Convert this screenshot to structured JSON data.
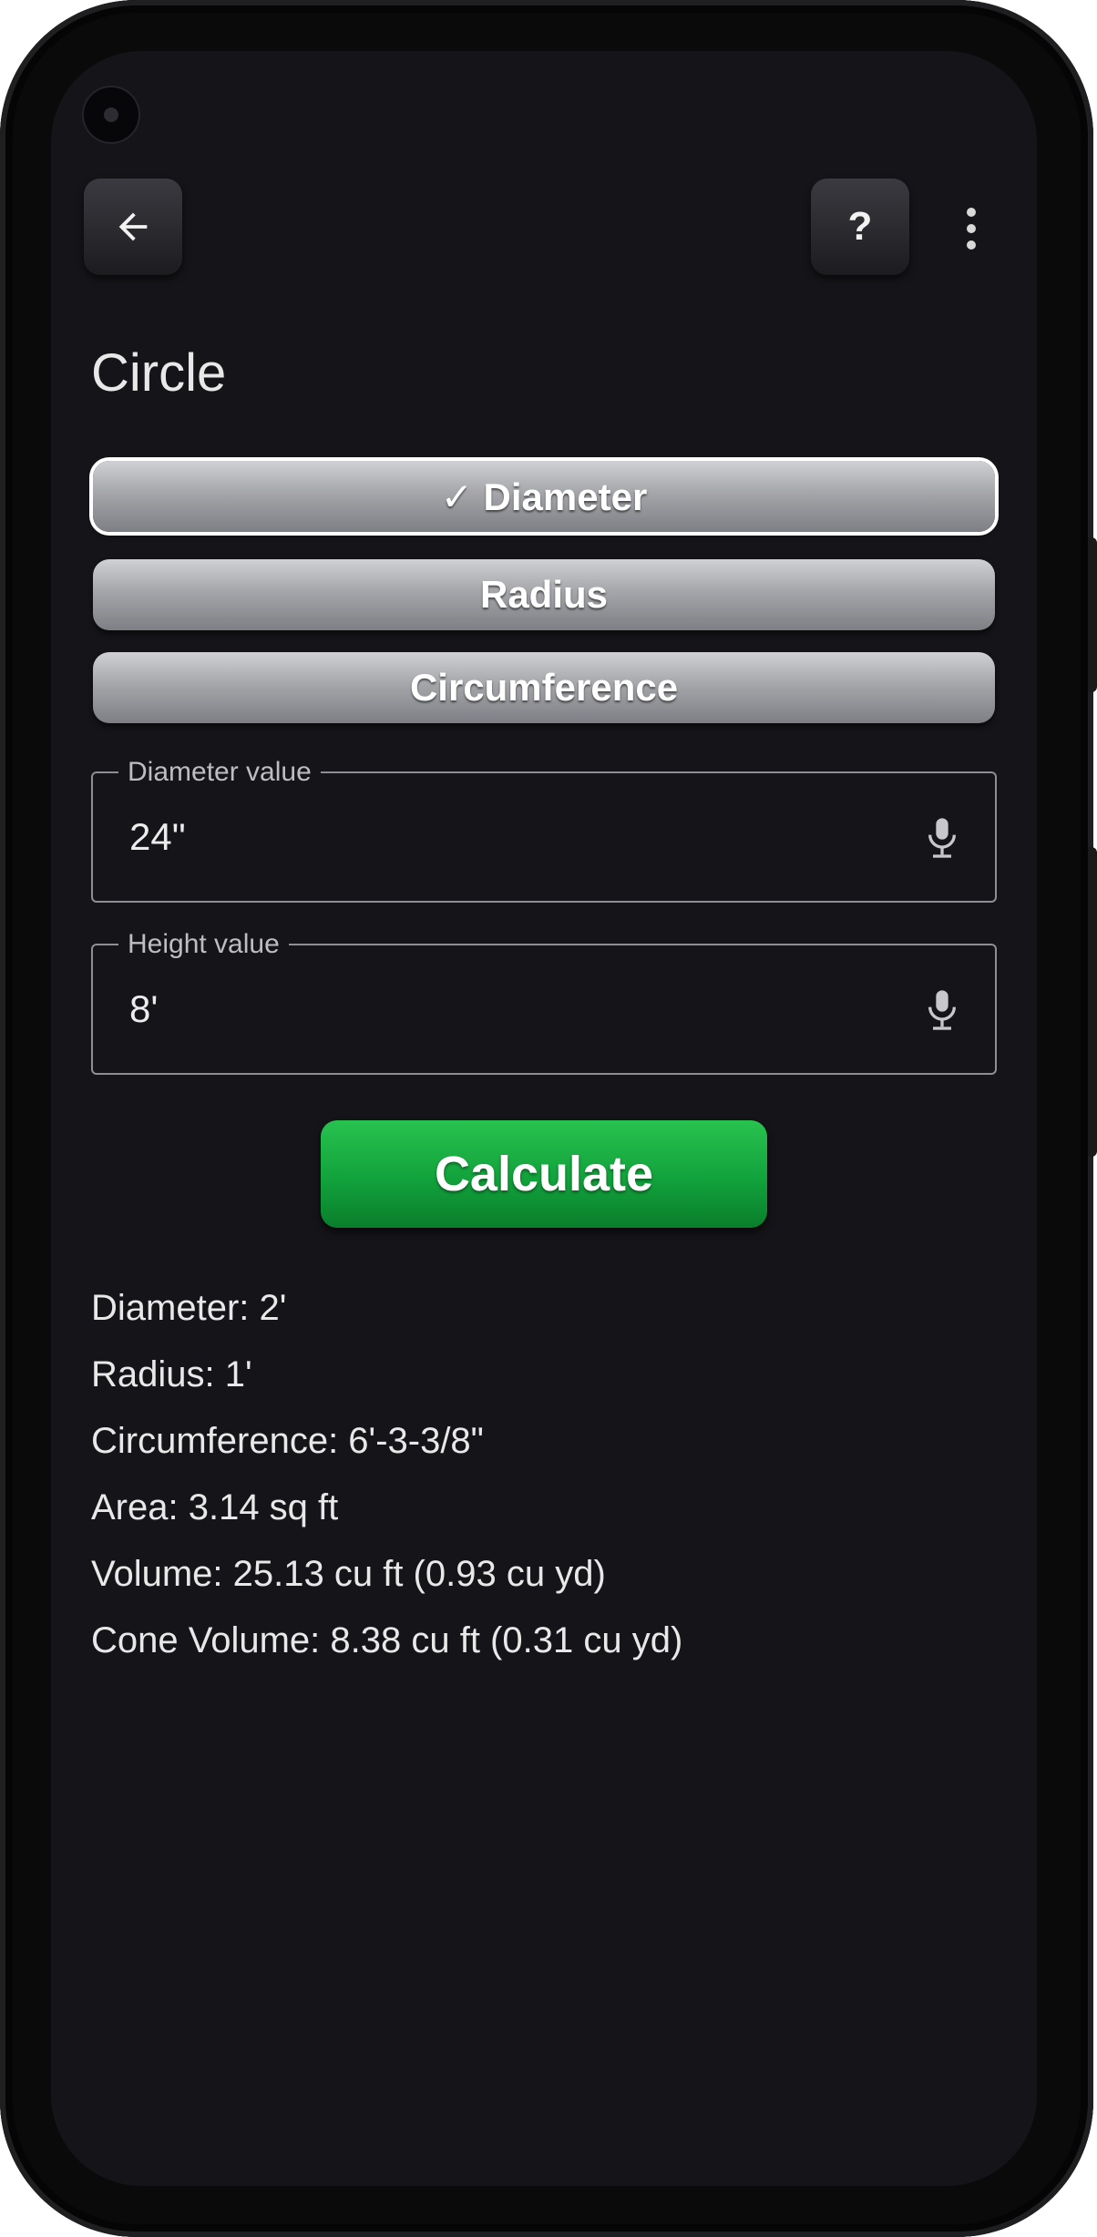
{
  "header": {
    "title": "Circle",
    "help_label": "?",
    "back_icon": "arrow-left-icon",
    "menu_icon": "more-vert-icon"
  },
  "mode_selector": {
    "selected": "Diameter",
    "options": [
      "✓ Diameter",
      "Radius",
      "Circumference"
    ]
  },
  "inputs": {
    "diameter": {
      "label": "Diameter value",
      "value": "24\"",
      "icon": "mic-icon"
    },
    "height": {
      "label": "Height value",
      "value": "8'",
      "icon": "mic-icon"
    }
  },
  "calculate_label": "Calculate",
  "results": [
    "Diameter: 2'",
    "Radius: 1'",
    "Circumference: 6'-3-3/8\"",
    "Area: 3.14 sq ft",
    "Volume: 25.13 cu ft (0.93 cu yd)",
    "Cone Volume: 8.38 cu ft (0.31 cu yd)"
  ],
  "colors": {
    "background": "#151519",
    "accent_green": "#12a23c",
    "segment_gray": "#a5a6aa",
    "text": "#e8e8e8"
  }
}
